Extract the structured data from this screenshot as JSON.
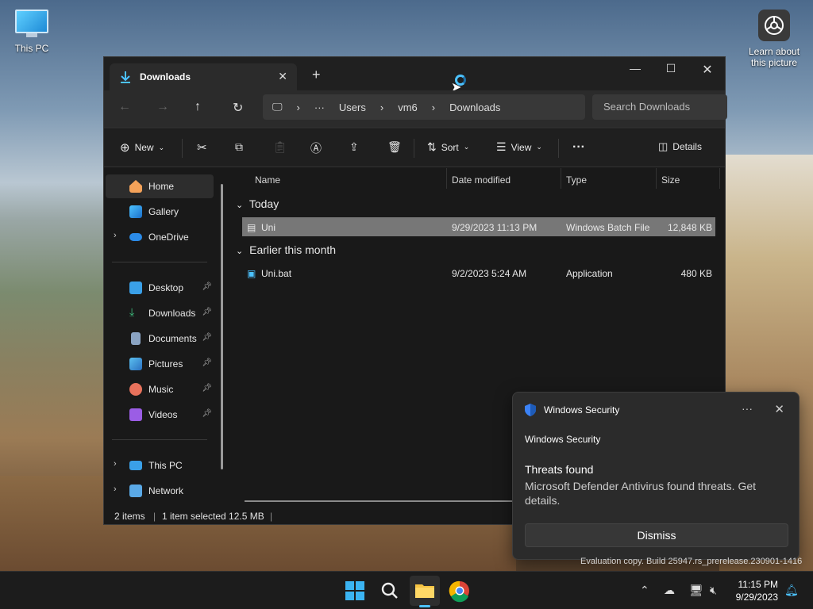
{
  "desktop": {
    "icons": [
      {
        "label": "This PC"
      },
      {
        "label": "Learn about this picture"
      }
    ]
  },
  "explorer": {
    "tab": {
      "label": "Downloads"
    },
    "nav": {
      "address": [
        "Users",
        "vm6",
        "Downloads"
      ],
      "search_placeholder": "Search Downloads"
    },
    "commands": {
      "new": "New",
      "sort": "Sort",
      "view": "View",
      "details": "Details"
    },
    "sidebar": {
      "items": [
        {
          "label": "Home"
        },
        {
          "label": "Gallery"
        },
        {
          "label": "OneDrive"
        },
        {
          "label": "Desktop"
        },
        {
          "label": "Downloads"
        },
        {
          "label": "Documents"
        },
        {
          "label": "Pictures"
        },
        {
          "label": "Music"
        },
        {
          "label": "Videos"
        },
        {
          "label": "This PC"
        },
        {
          "label": "Network"
        }
      ]
    },
    "columns": [
      "Name",
      "Date modified",
      "Type",
      "Size"
    ],
    "groups": [
      {
        "label": "Today",
        "files": [
          {
            "name": "Uni",
            "date": "9/29/2023 11:13 PM",
            "type": "Windows Batch File",
            "size": "12,848 KB"
          }
        ]
      },
      {
        "label": "Earlier this month",
        "files": [
          {
            "name": "Uni.bat",
            "date": "9/2/2023 5:24 AM",
            "type": "Application",
            "size": "480 KB"
          }
        ]
      }
    ],
    "status": {
      "count": "2 items",
      "selection": "1 item selected 12.5 MB"
    }
  },
  "toast": {
    "source": "Windows Security",
    "app": "Windows Security",
    "title": "Threats found",
    "message": "Microsoft Defender Antivirus found threats. Get details.",
    "dismiss": "Dismiss"
  },
  "watermark": "Evaluation copy. Build 25947.rs_prerelease.230901-1416",
  "taskbar": {
    "time": "11:15 PM",
    "date": "9/29/2023"
  },
  "colors": {
    "accent": "#4cc2ff",
    "folder": "#f6c443"
  }
}
